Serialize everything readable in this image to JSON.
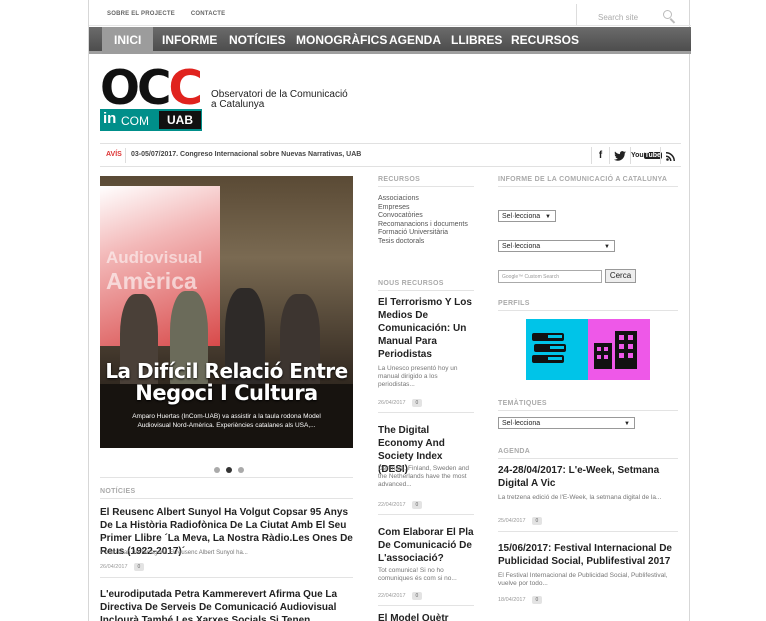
{
  "topbar": {
    "link1": "SOBRE EL PROJECTE",
    "link2": "CONTACTE",
    "search_placeholder": "Search site"
  },
  "nav": {
    "items": [
      "INICI",
      "INFORME",
      "NOTÍCIES",
      "MONOGRÀFICS",
      "AGENDA",
      "LLIBRES",
      "RECURSOS"
    ],
    "active": "INICI"
  },
  "logo": {
    "occ_black": "OC",
    "occ_red": "C",
    "incom_in": "in",
    "incom_com": "COM",
    "incom_uab": "UAB"
  },
  "site": {
    "line1": "Observatori de la Comunicació",
    "line2": "a Catalunya"
  },
  "avis": {
    "label": "AVÍS",
    "text": "03-05/07/2017. Congreso Internacional sobre Nuevas Narrativas, UAB"
  },
  "social": [
    "f",
    "t",
    "You Tube",
    "rss"
  ],
  "slider": {
    "title_line1": "La Difícil Relació Entre",
    "title_line2": "Negoci I Cultura",
    "sub": "Amparo Huertas (InCom-UAB) va assistir a la taula rodona Model Audiovisual Nord-Amèrica. Experiències catalanes als USA,...",
    "screen_line1": "Audiovisual",
    "screen_line2": "Amèrica"
  },
  "noticies": {
    "heading": "NOTÍCIES",
    "items": [
      {
        "title": "El Reusenc Albert Sunyol Ha Volgut Copsar 95 Anys De La Història Radiofònica De La Ciutat Amb El Seu Primer Llibre ´La Meva, La Nostra Ràdio.Les Ones De Reus (1922-2017)´",
        "excerpt": "+ info: Diari de Tarragona El reusenc Albert Sunyol ha...",
        "date": "26/04/2017",
        "count": "0"
      },
      {
        "title": "L'eurodiputada Petra Kammerevert Afirma Que La Directiva De Serveis De Comunicació Audiovisual Inclourà També Les Xarxes Socials Si Tenen Contingut Audiovisual",
        "excerpt": "",
        "date": "",
        "count": ""
      }
    ]
  },
  "recursos": {
    "heading": "RECURSOS",
    "items": [
      "Associacions",
      "Empreses",
      "Convocatòries",
      "Recomanacions i documents",
      "Formació Universitària",
      "Tesis doctorals"
    ]
  },
  "nous_recursos": {
    "heading": "NOUS RECURSOS",
    "items": [
      {
        "title": "El Terrorismo Y Los Medios De Comunicación: Un Manual Para Periodistas",
        "excerpt": "La Unesco presentó hoy un manual dirigido a los periodistas...",
        "date": "26/04/2017",
        "count": "0"
      },
      {
        "title": "The Digital Economy And Society Index (DESI)",
        "excerpt": "Denmark, Finland, Sweden and the Netherlands have the most advanced...",
        "date": "22/04/2017",
        "count": "0"
      },
      {
        "title": "Com Elaborar El Pla De Comunicació De L'associació?",
        "excerpt": "Tot comunica! Si no ho comuniques és com si no...",
        "date": "22/04/2017",
        "count": "0"
      },
      {
        "title": "El Model Quètr",
        "excerpt": "",
        "date": "",
        "count": ""
      }
    ]
  },
  "informe": {
    "heading": "INFORME DE LA COMUNICACIÓ A CATALUNYA",
    "select1": "Sel·lecciona",
    "select2": "Sel·lecciona",
    "gsearch": "Google™ Custom Search",
    "cerca": "Cerca"
  },
  "perfils": {
    "heading": "PERFILS"
  },
  "tematiques": {
    "heading": "TEMÀTIQUES",
    "select": "Sel·lecciona"
  },
  "agenda": {
    "heading": "AGENDA",
    "items": [
      {
        "title": "24-28/04/2017: L'e-Week, Setmana Digital A Vic",
        "excerpt": "La tretzena edició de l'E-Week, la setmana digital de la...",
        "date": "25/04/2017",
        "count": "0"
      },
      {
        "title": "15/06/2017: Festival Internacional De Publicidad Social, Publifestival 2017",
        "excerpt": "El Festival Internacional de Publicidad Social, Publifestival, vuelve por todo...",
        "date": "18/04/2017",
        "count": "0"
      }
    ]
  },
  "colors": {
    "accent_red": "#e0231e",
    "incom_teal": "#008f8a",
    "perfil_blue": "#00c4e8",
    "perfil_pink": "#ee58e8",
    "nav_bg": "#5a5a5a"
  }
}
